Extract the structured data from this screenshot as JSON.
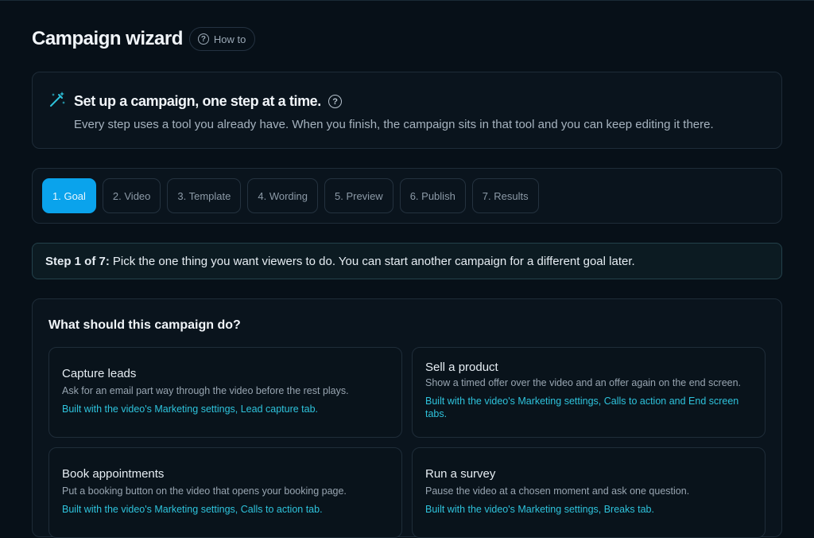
{
  "header": {
    "title": "Campaign wizard",
    "howto_label": "How to"
  },
  "intro": {
    "title": "Set up a campaign, one step at a time.",
    "description": "Every step uses a tool you already have. When you finish, the campaign sits in that tool and you can keep editing it there."
  },
  "steps": [
    {
      "label": "1. Goal",
      "active": true
    },
    {
      "label": "2. Video",
      "active": false
    },
    {
      "label": "3. Template",
      "active": false
    },
    {
      "label": "4. Wording",
      "active": false
    },
    {
      "label": "5. Preview",
      "active": false
    },
    {
      "label": "6. Publish",
      "active": false
    },
    {
      "label": "7. Results",
      "active": false
    }
  ],
  "step_info": {
    "prefix": "Step 1 of 7:",
    "text": "Pick the one thing you want viewers to do. You can start another campaign for a different goal later."
  },
  "goals": {
    "heading": "What should this campaign do?",
    "options": [
      {
        "title": "Capture leads",
        "description": "Ask for an email part way through the video before the rest plays.",
        "built_with": "Built with the video's Marketing settings, Lead capture tab."
      },
      {
        "title": "Sell a product",
        "description": "Show a timed offer over the video and an offer again on the end screen.",
        "built_with": "Built with the video's Marketing settings, Calls to action and End screen tabs."
      },
      {
        "title": "Book appointments",
        "description": "Put a booking button on the video that opens your booking page.",
        "built_with": "Built with the video's Marketing settings, Calls to action tab."
      },
      {
        "title": "Run a survey",
        "description": "Pause the video at a chosen moment and ask one question.",
        "built_with": "Built with the video's Marketing settings, Breaks tab."
      }
    ]
  },
  "colors": {
    "background": "#071018",
    "accent": "#0aa3ec",
    "link": "#2ec3dc"
  },
  "icons": {
    "howto": "question-circle-icon",
    "intro": "magic-wand-icon",
    "intro_help": "question-circle-icon"
  }
}
